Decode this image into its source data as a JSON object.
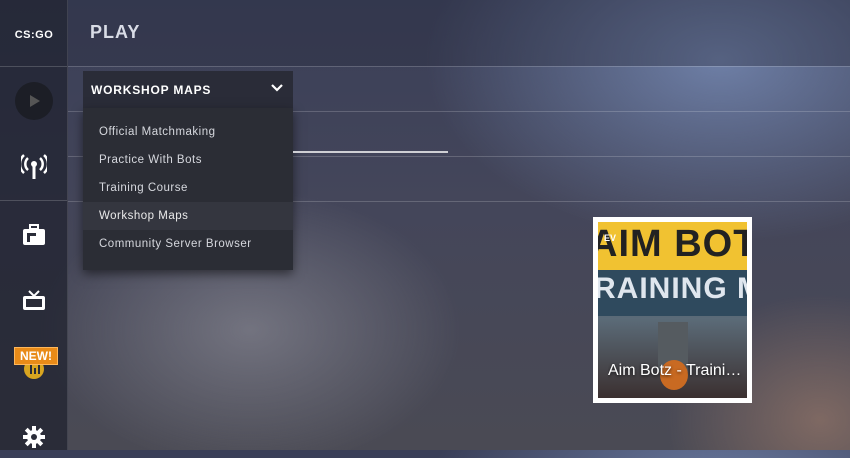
{
  "app": {
    "logo_text": "CS:GO"
  },
  "header": {
    "title": "PLAY"
  },
  "mode_select": {
    "selected": "WORKSHOP MAPS"
  },
  "dropdown": {
    "items": [
      {
        "label": "Official Matchmaking"
      },
      {
        "label": "Practice With Bots"
      },
      {
        "label": "Training Course"
      },
      {
        "label": "Workshop Maps"
      },
      {
        "label": "Community Server Browser"
      }
    ]
  },
  "sidebar": {
    "items": [
      {
        "icon": "play-icon"
      },
      {
        "icon": "broadcast-icon"
      },
      {
        "icon": "inventory-icon"
      },
      {
        "icon": "tv-icon"
      },
      {
        "icon": "operation-icon",
        "badge": "NEW!"
      },
      {
        "icon": "gear-icon"
      }
    ]
  },
  "map_card": {
    "name": "Aim Botz - Training Map",
    "thumb_line1": "AIM BOT",
    "thumb_line2": "RAINING MA",
    "thumb_tag": "EV"
  },
  "colors": {
    "accent_badge": "#e98b18",
    "card_border": "#ffffff"
  }
}
